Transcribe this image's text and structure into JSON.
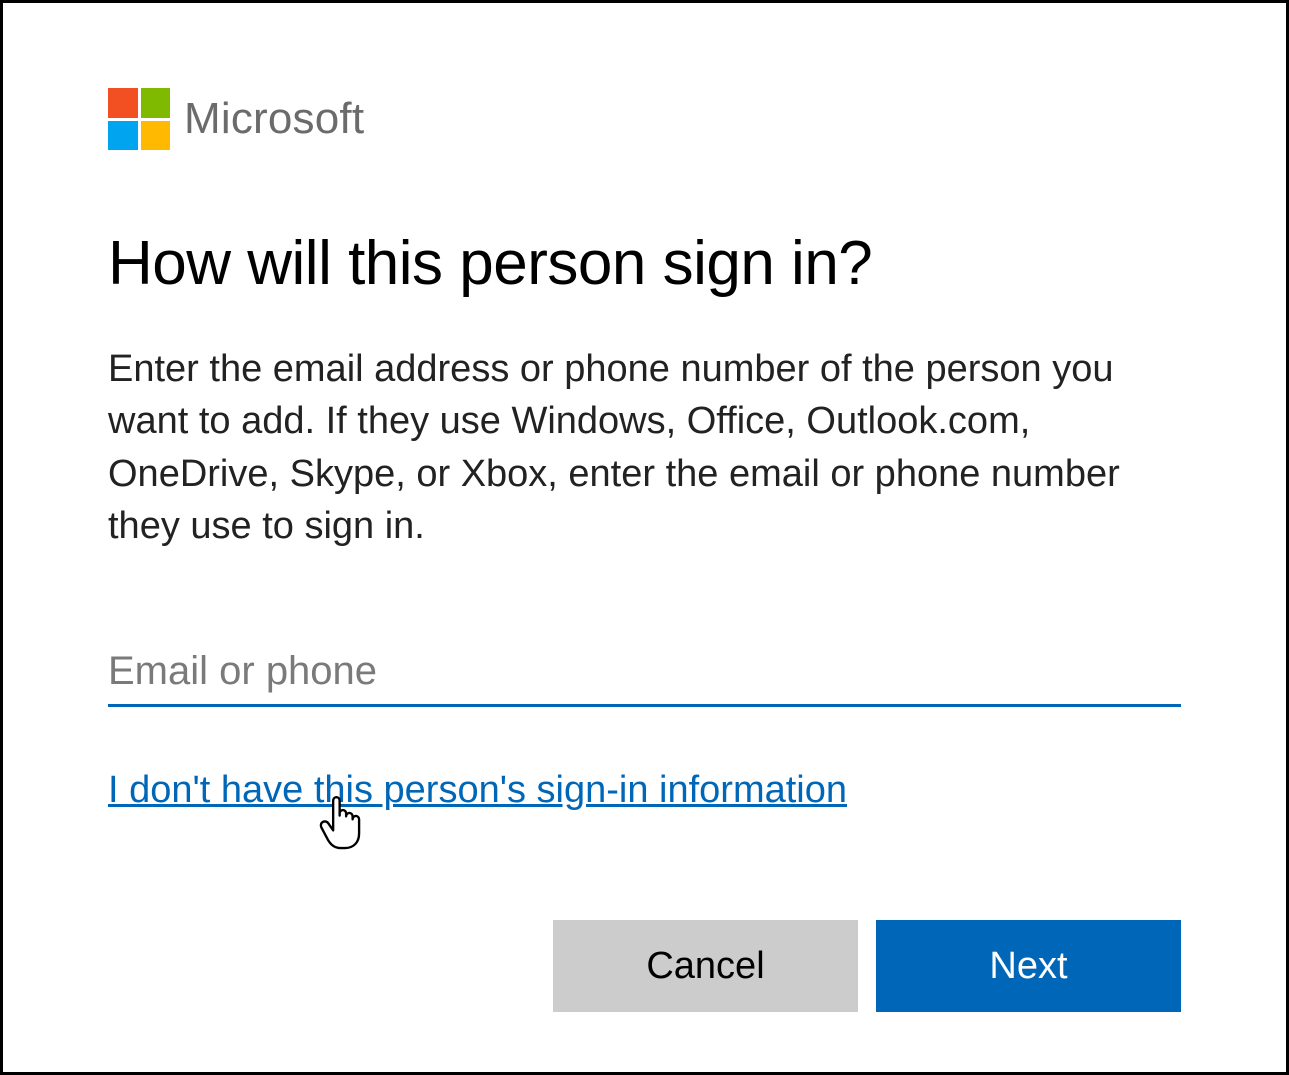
{
  "brand": {
    "name": "Microsoft",
    "logo_colors": {
      "red": "#f25022",
      "green": "#7fba00",
      "blue": "#00a4ef",
      "yellow": "#ffb900"
    }
  },
  "heading": "How will this person sign in?",
  "description": "Enter the email address or phone number of the person you want to add. If they use Windows, Office, Outlook.com, OneDrive, Skype, or Xbox, enter the email or phone number they use to sign in.",
  "input": {
    "placeholder": "Email or phone",
    "value": ""
  },
  "link": {
    "no_info": "I don't have this person's sign-in information"
  },
  "buttons": {
    "cancel": "Cancel",
    "next": "Next"
  },
  "accent_color": "#0067b8"
}
